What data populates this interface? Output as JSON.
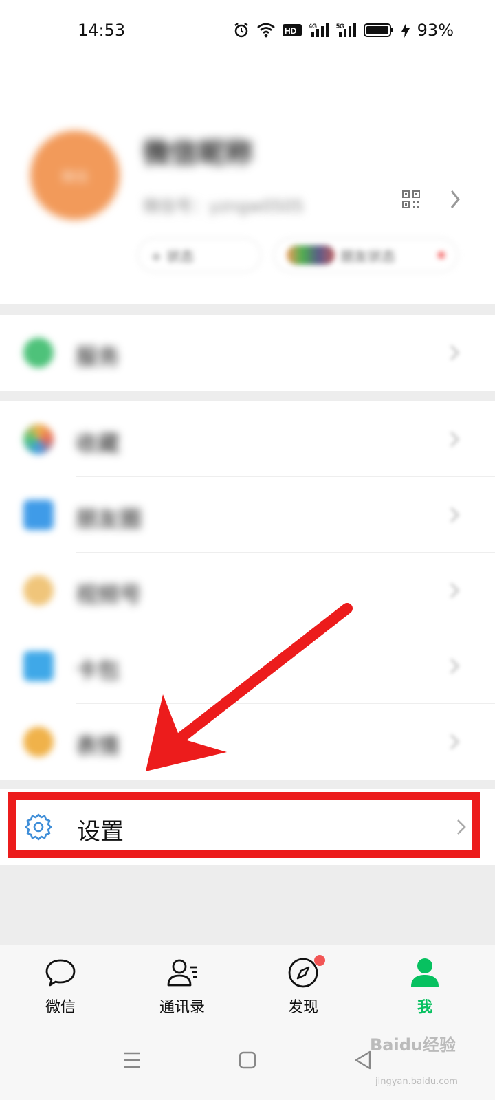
{
  "status_bar": {
    "time": "14:53",
    "battery": "93%",
    "icons": [
      "alarm-icon",
      "wifi-icon",
      "hd-icon",
      "signal-4g-icon",
      "signal-5g-icon",
      "battery-icon",
      "charging-icon"
    ]
  },
  "profile": {
    "nickname": "微信昵称",
    "wechat_id": "微信号：yzngw0505",
    "avatar_text": "微信",
    "status_pill": "+ 状态",
    "friends_pill": "朋友状态"
  },
  "menu": {
    "items": [
      {
        "label": "服务",
        "icon": "service-icon",
        "color": "#4ec27a"
      },
      {
        "label": "收藏",
        "icon": "favorites-icon",
        "color": "#f0b24a"
      },
      {
        "label": "朋友圈",
        "icon": "moments-icon",
        "color": "#3f9be8"
      },
      {
        "label": "视频号",
        "icon": "channels-icon",
        "color": "#f0c57a"
      },
      {
        "label": "卡包",
        "icon": "cards-icon",
        "color": "#3fa8e8"
      },
      {
        "label": "表情",
        "icon": "stickers-icon",
        "color": "#f0b24a"
      }
    ],
    "settings_label": "设置"
  },
  "tabbar": {
    "tabs": [
      {
        "label": "微信",
        "icon": "chat-icon"
      },
      {
        "label": "通讯录",
        "icon": "contacts-icon"
      },
      {
        "label": "发现",
        "icon": "discover-icon"
      },
      {
        "label": "我",
        "icon": "me-icon"
      }
    ],
    "active": "我",
    "accent": "#07c160"
  },
  "watermark": {
    "text": "Baidu经验",
    "sub": "jingyan.baidu.com"
  }
}
